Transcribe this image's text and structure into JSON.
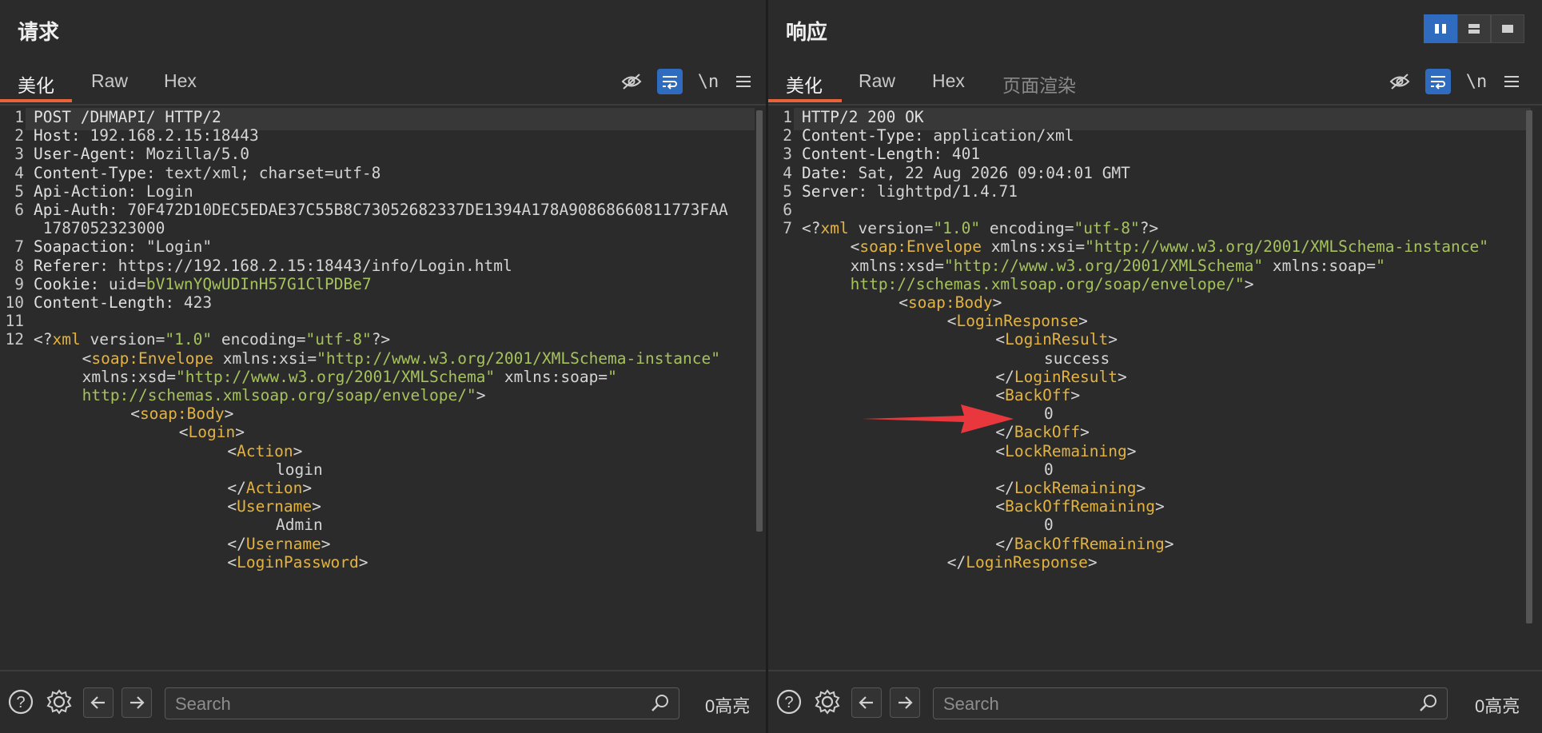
{
  "request": {
    "title": "请求",
    "tabs": [
      "美化",
      "Raw",
      "Hex"
    ],
    "toolbar": {
      "newline_label": "\\n"
    },
    "lines": [
      {
        "n": "1",
        "parts": [
          [
            "k",
            "POST /DHMAPI/ HTTP/2"
          ]
        ]
      },
      {
        "n": "2",
        "parts": [
          [
            "k",
            "Host"
          ],
          [
            "v",
            ": 192.168.2.15:18443"
          ]
        ]
      },
      {
        "n": "3",
        "parts": [
          [
            "k",
            "User-Agent"
          ],
          [
            "v",
            ": Mozilla/5.0"
          ]
        ]
      },
      {
        "n": "4",
        "parts": [
          [
            "k",
            "Content-Type"
          ],
          [
            "v",
            ": text/xml; charset=utf-8"
          ]
        ]
      },
      {
        "n": "5",
        "parts": [
          [
            "k",
            "Api-Action"
          ],
          [
            "v",
            ": Login"
          ]
        ]
      },
      {
        "n": "6",
        "parts": [
          [
            "k",
            "Api-Auth"
          ],
          [
            "v",
            ": 70F472D10DEC5EDAE37C55B8C73052682337DE1394A178A90868660811773FAA"
          ]
        ]
      },
      {
        "n": "",
        "parts": [
          [
            "v",
            " 1787052323000"
          ]
        ]
      },
      {
        "n": "7",
        "parts": [
          [
            "k",
            "Soapaction"
          ],
          [
            "v",
            ": \"Login\""
          ]
        ]
      },
      {
        "n": "8",
        "parts": [
          [
            "k",
            "Referer"
          ],
          [
            "v",
            ": https://192.168.2.15:18443/info/Login.html"
          ]
        ]
      },
      {
        "n": "9",
        "parts": [
          [
            "k",
            "Cookie"
          ],
          [
            "v",
            ": uid="
          ],
          [
            "ck",
            "bV1wnYQwUDInH57G1ClPDBe7"
          ]
        ]
      },
      {
        "n": "10",
        "parts": [
          [
            "k",
            "Content-Length"
          ],
          [
            "v",
            ": 423"
          ]
        ]
      },
      {
        "n": "11",
        "parts": []
      },
      {
        "n": "12",
        "parts": [
          [
            "br",
            "<?"
          ],
          [
            "tag",
            "xml"
          ],
          [
            "att",
            " version="
          ],
          [
            "str",
            "\"1.0\""
          ],
          [
            "att",
            " encoding="
          ],
          [
            "str",
            "\"utf-8\""
          ],
          [
            "br",
            "?>"
          ]
        ]
      },
      {
        "n": "",
        "indent": 6,
        "parts": [
          [
            "br",
            "<"
          ],
          [
            "tag",
            "soap:Envelope"
          ],
          [
            "att",
            " xmlns:xsi="
          ],
          [
            "str",
            "\"http://www.w3.org/2001/XMLSchema-instance\""
          ]
        ]
      },
      {
        "n": "",
        "indent": 6,
        "parts": [
          [
            "att",
            "xmlns:xsd="
          ],
          [
            "str",
            "\"http://www.w3.org/2001/XMLSchema\""
          ],
          [
            "att",
            " xmlns:soap="
          ],
          [
            "str",
            "\""
          ]
        ]
      },
      {
        "n": "",
        "indent": 6,
        "parts": [
          [
            "str",
            "http://schemas.xmlsoap.org/soap/envelope/\""
          ],
          [
            "br",
            ">"
          ]
        ]
      },
      {
        "n": "",
        "indent": 12,
        "parts": [
          [
            "br",
            "<"
          ],
          [
            "tag",
            "soap:Body"
          ],
          [
            "br",
            ">"
          ]
        ]
      },
      {
        "n": "",
        "indent": 18,
        "parts": [
          [
            "br",
            "<"
          ],
          [
            "tag",
            "Login"
          ],
          [
            "br",
            ">"
          ]
        ]
      },
      {
        "n": "",
        "indent": 24,
        "parts": [
          [
            "br",
            "<"
          ],
          [
            "tag",
            "Action"
          ],
          [
            "br",
            ">"
          ]
        ]
      },
      {
        "n": "",
        "indent": 30,
        "parts": [
          [
            "v",
            "login"
          ]
        ]
      },
      {
        "n": "",
        "indent": 24,
        "parts": [
          [
            "br",
            "</"
          ],
          [
            "tag",
            "Action"
          ],
          [
            "br",
            ">"
          ]
        ]
      },
      {
        "n": "",
        "indent": 24,
        "parts": [
          [
            "br",
            "<"
          ],
          [
            "tag",
            "Username"
          ],
          [
            "br",
            ">"
          ]
        ]
      },
      {
        "n": "",
        "indent": 30,
        "parts": [
          [
            "v",
            "Admin"
          ]
        ]
      },
      {
        "n": "",
        "indent": 24,
        "parts": [
          [
            "br",
            "</"
          ],
          [
            "tag",
            "Username"
          ],
          [
            "br",
            ">"
          ]
        ]
      },
      {
        "n": "",
        "indent": 24,
        "parts": [
          [
            "br",
            "<"
          ],
          [
            "tag",
            "LoginPassword"
          ],
          [
            "br",
            ">"
          ]
        ]
      }
    ],
    "search_placeholder": "Search",
    "highlight_count": "0高亮"
  },
  "response": {
    "title": "响应",
    "tabs": [
      "美化",
      "Raw",
      "Hex",
      "页面渲染"
    ],
    "toolbar": {
      "newline_label": "\\n"
    },
    "lines": [
      {
        "n": "1",
        "parts": [
          [
            "k",
            "HTTP/2 200 OK"
          ]
        ]
      },
      {
        "n": "2",
        "parts": [
          [
            "k",
            "Content-Type"
          ],
          [
            "v",
            ": application/xml"
          ]
        ]
      },
      {
        "n": "3",
        "parts": [
          [
            "k",
            "Content-Length"
          ],
          [
            "v",
            ": 401"
          ]
        ]
      },
      {
        "n": "4",
        "parts": [
          [
            "k",
            "Date"
          ],
          [
            "v",
            ": Sat, 22 Aug 2026 09:04:01 GMT"
          ]
        ]
      },
      {
        "n": "5",
        "parts": [
          [
            "k",
            "Server"
          ],
          [
            "v",
            ": lighttpd/1.4.71"
          ]
        ]
      },
      {
        "n": "6",
        "parts": []
      },
      {
        "n": "7",
        "parts": [
          [
            "br",
            "<?"
          ],
          [
            "tag",
            "xml"
          ],
          [
            "att",
            " version="
          ],
          [
            "str",
            "\"1.0\""
          ],
          [
            "att",
            " encoding="
          ],
          [
            "str",
            "\"utf-8\""
          ],
          [
            "br",
            "?>"
          ]
        ]
      },
      {
        "n": "",
        "indent": 6,
        "parts": [
          [
            "br",
            "<"
          ],
          [
            "tag",
            "soap:Envelope"
          ],
          [
            "att",
            " xmlns:xsi="
          ],
          [
            "str",
            "\"http://www.w3.org/2001/XMLSchema-instance\""
          ]
        ]
      },
      {
        "n": "",
        "indent": 6,
        "parts": [
          [
            "att",
            "xmlns:xsd="
          ],
          [
            "str",
            "\"http://www.w3.org/2001/XMLSchema\""
          ],
          [
            "att",
            " xmlns:soap="
          ],
          [
            "str",
            "\""
          ]
        ]
      },
      {
        "n": "",
        "indent": 6,
        "parts": [
          [
            "str",
            "http://schemas.xmlsoap.org/soap/envelope/\""
          ],
          [
            "br",
            ">"
          ]
        ]
      },
      {
        "n": "",
        "indent": 12,
        "parts": [
          [
            "br",
            "<"
          ],
          [
            "tag",
            "soap:Body"
          ],
          [
            "br",
            ">"
          ]
        ]
      },
      {
        "n": "",
        "indent": 18,
        "parts": [
          [
            "br",
            "<"
          ],
          [
            "tag",
            "LoginResponse"
          ],
          [
            "br",
            ">"
          ]
        ]
      },
      {
        "n": "",
        "indent": 24,
        "parts": [
          [
            "br",
            "<"
          ],
          [
            "tag",
            "LoginResult"
          ],
          [
            "br",
            ">"
          ]
        ]
      },
      {
        "n": "",
        "indent": 30,
        "parts": [
          [
            "v",
            "success"
          ]
        ]
      },
      {
        "n": "",
        "indent": 24,
        "parts": [
          [
            "br",
            "</"
          ],
          [
            "tag",
            "LoginResult"
          ],
          [
            "br",
            ">"
          ]
        ]
      },
      {
        "n": "",
        "indent": 24,
        "parts": [
          [
            "br",
            "<"
          ],
          [
            "tag",
            "BackOff"
          ],
          [
            "br",
            ">"
          ]
        ]
      },
      {
        "n": "",
        "indent": 30,
        "parts": [
          [
            "v",
            "0"
          ]
        ]
      },
      {
        "n": "",
        "indent": 24,
        "parts": [
          [
            "br",
            "</"
          ],
          [
            "tag",
            "BackOff"
          ],
          [
            "br",
            ">"
          ]
        ]
      },
      {
        "n": "",
        "indent": 24,
        "parts": [
          [
            "br",
            "<"
          ],
          [
            "tag",
            "LockRemaining"
          ],
          [
            "br",
            ">"
          ]
        ]
      },
      {
        "n": "",
        "indent": 30,
        "parts": [
          [
            "v",
            "0"
          ]
        ]
      },
      {
        "n": "",
        "indent": 24,
        "parts": [
          [
            "br",
            "</"
          ],
          [
            "tag",
            "LockRemaining"
          ],
          [
            "br",
            ">"
          ]
        ]
      },
      {
        "n": "",
        "indent": 24,
        "parts": [
          [
            "br",
            "<"
          ],
          [
            "tag",
            "BackOffRemaining"
          ],
          [
            "br",
            ">"
          ]
        ]
      },
      {
        "n": "",
        "indent": 30,
        "parts": [
          [
            "v",
            "0"
          ]
        ]
      },
      {
        "n": "",
        "indent": 24,
        "parts": [
          [
            "br",
            "</"
          ],
          [
            "tag",
            "BackOffRemaining"
          ],
          [
            "br",
            ">"
          ]
        ]
      },
      {
        "n": "",
        "indent": 18,
        "parts": [
          [
            "br",
            "</"
          ],
          [
            "tag",
            "LoginResponse"
          ],
          [
            "br",
            ">"
          ]
        ]
      }
    ],
    "search_placeholder": "Search",
    "highlight_count": "0高亮"
  },
  "colors": {
    "accent": "#2f6bbf",
    "tab_underline": "#e8623a",
    "tag": "#e3b341",
    "string": "#a5c25c",
    "arrow": "#e8383d"
  }
}
